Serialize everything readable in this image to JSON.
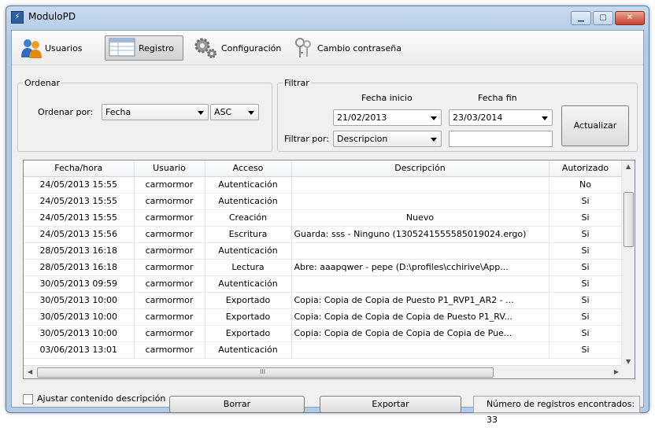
{
  "window": {
    "title": "ModuloPD"
  },
  "toolbar": {
    "usuarios": "Usuarios",
    "registro": "Registro",
    "configuracion": "Configuración",
    "cambio_contrasena": "Cambio contraseña"
  },
  "ordenar": {
    "group_label": "Ordenar",
    "label": "Ordenar por:",
    "field_value": "Fecha",
    "order_value": "ASC"
  },
  "filtrar": {
    "group_label": "Filtrar",
    "fecha_inicio_label": "Fecha inicio",
    "fecha_fin_label": "Fecha fin",
    "fecha_inicio": "21/02/2013",
    "fecha_fin": "23/03/2014",
    "filtrar_por_label": "Filtrar por:",
    "filtrar_por_value": "Descripcion",
    "texto": "",
    "actualizar": "Actualizar"
  },
  "table": {
    "columns": [
      "Fecha/hora",
      "Usuario",
      "Acceso",
      "Descripción",
      "Autorizado"
    ],
    "rows": [
      [
        "24/05/2013 15:55",
        "carmormor",
        "Autenticación",
        "",
        "No"
      ],
      [
        "24/05/2013 15:55",
        "carmormor",
        "Autenticación",
        "",
        "Si"
      ],
      [
        "24/05/2013 15:55",
        "carmormor",
        "Creación",
        "Nuevo",
        "Si"
      ],
      [
        "24/05/2013 15:56",
        "carmormor",
        "Escritura",
        "Guarda: sss - Ninguno (1305241555585019024.ergo)",
        "Si"
      ],
      [
        "28/05/2013 16:18",
        "carmormor",
        "Autenticación",
        "",
        "Si"
      ],
      [
        "28/05/2013 16:18",
        "carmormor",
        "Lectura",
        "Abre: aaapqwer - pepe (D:\\profiles\\cchirive\\App...",
        "Si"
      ],
      [
        "30/05/2013 09:59",
        "carmormor",
        "Autenticación",
        "",
        "Si"
      ],
      [
        "30/05/2013 10:00",
        "carmormor",
        "Exportado",
        "Copia: Copia de Copia de Puesto P1_RVP1_AR2 - ...",
        "Si"
      ],
      [
        "30/05/2013 10:00",
        "carmormor",
        "Exportado",
        "Copia: Copia de Copia de Copia de Puesto P1_RV...",
        "Si"
      ],
      [
        "30/05/2013 10:00",
        "carmormor",
        "Exportado",
        "Copia: Copia de Copia de Copia de Copia de Pue...",
        "Si"
      ],
      [
        "03/06/2013 13:01",
        "carmormor",
        "Autenticación",
        "",
        "Si"
      ]
    ],
    "hscroll_grip": "III"
  },
  "footer": {
    "ajustar_label": "Ajustar contenido descripción",
    "borrar": "Borrar",
    "exportar": "Exportar",
    "status": "Número de registros encontrados: 33"
  }
}
